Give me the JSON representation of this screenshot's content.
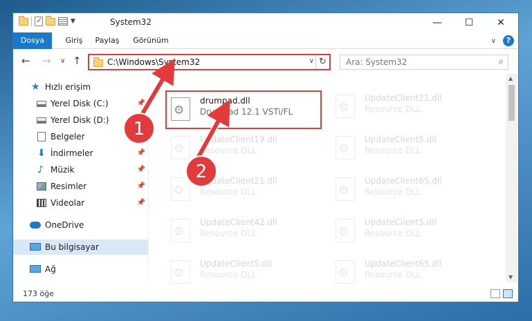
{
  "window": {
    "title": "System32",
    "controls": {
      "minimize": "—",
      "maximize": "☐",
      "close": "✕"
    }
  },
  "ribbon": {
    "tabs": [
      "Dosya",
      "Giriş",
      "Paylaş",
      "Görünüm"
    ],
    "help": "?"
  },
  "nav": {
    "back": "←",
    "forward": "→",
    "recent": "∨",
    "up": "↑",
    "address": "C:\\Windows\\System32",
    "refresh": "↻",
    "search_placeholder": "Ara: System32",
    "search_icon": "⌕"
  },
  "sidebar": {
    "items": [
      {
        "label": "Hızlı erişim",
        "icon": "star-icon",
        "pinned": false
      },
      {
        "label": "Yerel Disk (C:)",
        "icon": "drive-icon",
        "pinned": true
      },
      {
        "label": "Yerel Disk (D:)",
        "icon": "drive-icon",
        "pinned": true
      },
      {
        "label": "Belgeler",
        "icon": "document-icon",
        "pinned": true
      },
      {
        "label": "İndirmeler",
        "icon": "download-icon",
        "pinned": true
      },
      {
        "label": "Müzik",
        "icon": "music-icon",
        "pinned": true
      },
      {
        "label": "Resimler",
        "icon": "pictures-icon",
        "pinned": true
      },
      {
        "label": "Videolar",
        "icon": "videos-icon",
        "pinned": true
      },
      {
        "label": "OneDrive",
        "icon": "cloud-icon",
        "pinned": false
      },
      {
        "label": "Bu bilgisayar",
        "icon": "computer-icon",
        "pinned": false,
        "selected": true
      },
      {
        "label": "Ağ",
        "icon": "network-icon",
        "pinned": false
      }
    ],
    "pin_glyph": "📌"
  },
  "files": {
    "highlighted": {
      "name": "drumpad.dll",
      "desc": "Drumpad 12.1 VSTi/FL"
    },
    "left_column": [
      {
        "name": "UpdateClient19.dll",
        "desc": "Resource DLL"
      },
      {
        "name": "UpdateClient21.dll",
        "desc": "Resource DLL"
      },
      {
        "name": "UpdateClient42.dll",
        "desc": "Resource DLL"
      },
      {
        "name": "UpdateClient5.dll",
        "desc": "Resource DLL"
      }
    ],
    "right_column": [
      {
        "name": "UpdateClient21.dll",
        "desc": "Resource DLL"
      },
      {
        "name": "UpdateClient5.dll",
        "desc": "Resource DLL"
      },
      {
        "name": "UpdateClient65.dll",
        "desc": "Resource DLL"
      },
      {
        "name": "UpdateClient5.dll",
        "desc": "Resource DLL"
      },
      {
        "name": "UpdateClient65.dll",
        "desc": "Resource DLL"
      }
    ]
  },
  "status": {
    "count": "173 öğe"
  },
  "annotations": {
    "step1": "1",
    "step2": "2",
    "color": "#e33b3b"
  }
}
